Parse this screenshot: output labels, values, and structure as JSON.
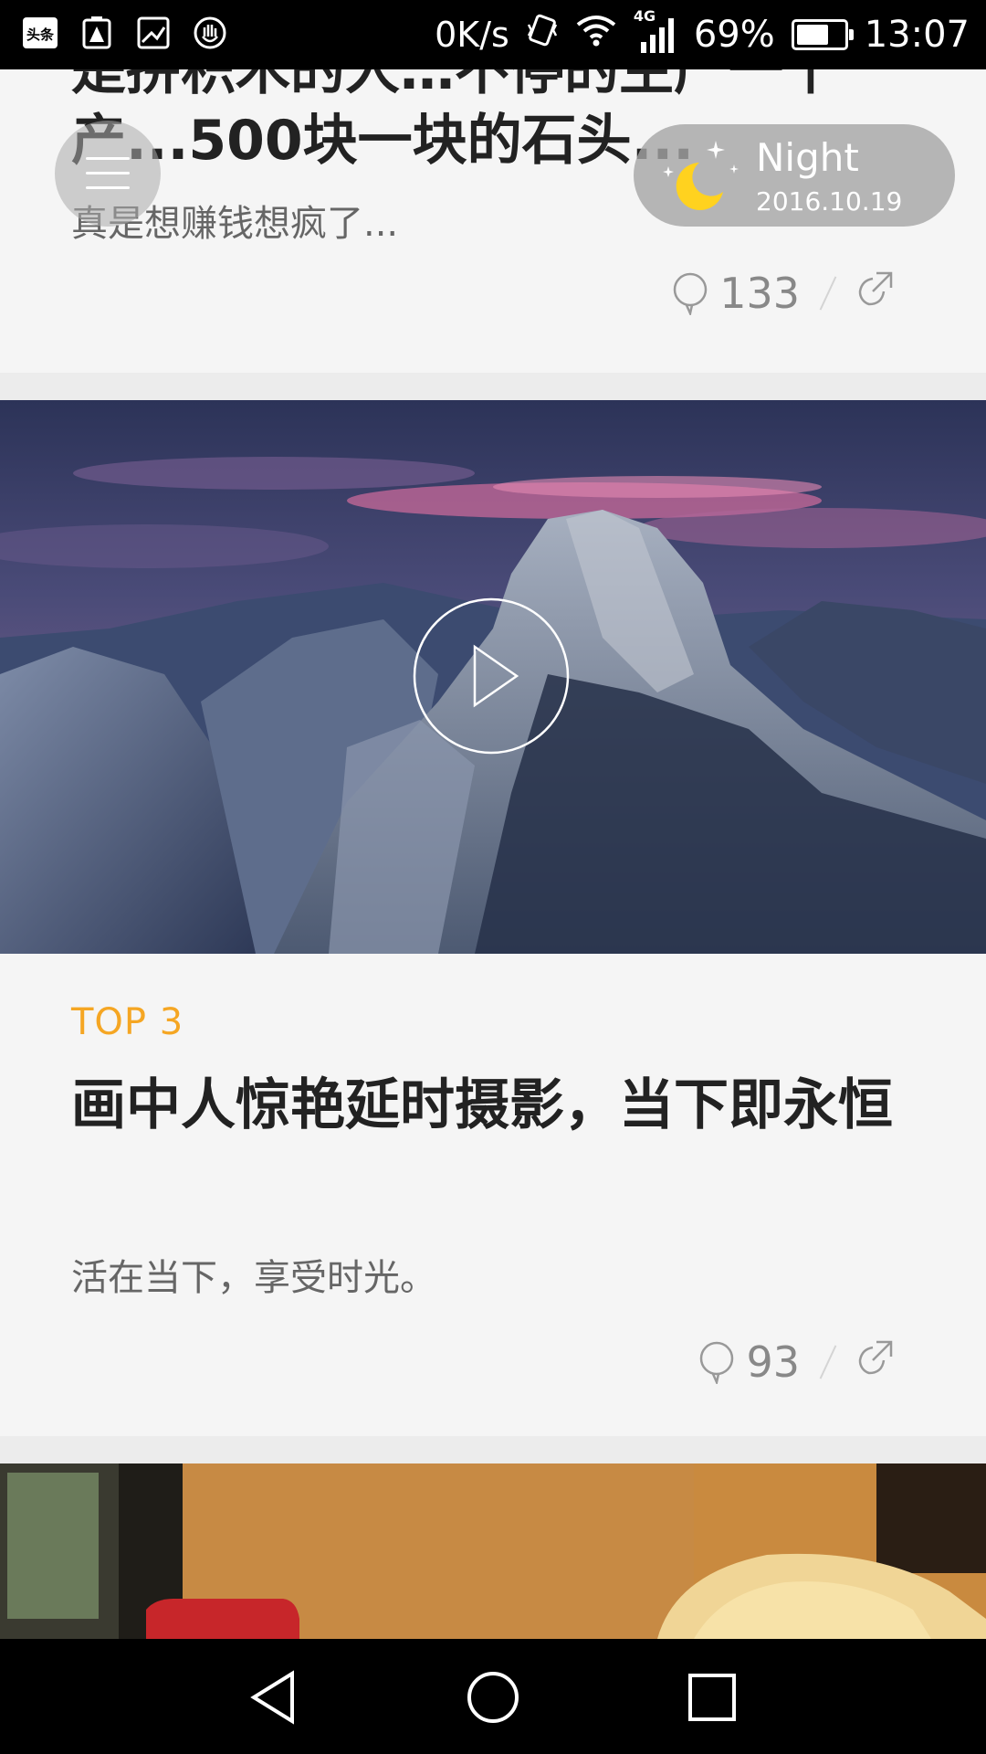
{
  "status_bar": {
    "left_icons": [
      "toutiao-icon",
      "battery-alert-icon",
      "image-icon",
      "hand-icon"
    ],
    "toutiao_badge": "头条",
    "net_speed": "0K/s",
    "network": "4G",
    "battery": "69%",
    "battery_level": 0.69,
    "time": "13:07"
  },
  "floating": {
    "night_label": "Night",
    "night_date": "2016.10.19"
  },
  "articles": [
    {
      "title": "产...500块一块的石头...",
      "subtitle": "真是想赚钱想疯了...",
      "comments": "133"
    },
    {
      "tag": "TOP 3",
      "title": "画中人惊艳延时摄影，当下即永恒",
      "subtitle": "活在当下，享受时光。",
      "comments": "93"
    }
  ],
  "colors": {
    "tag": "#f5a623",
    "background": "#f5f5f5",
    "title": "#222222"
  }
}
